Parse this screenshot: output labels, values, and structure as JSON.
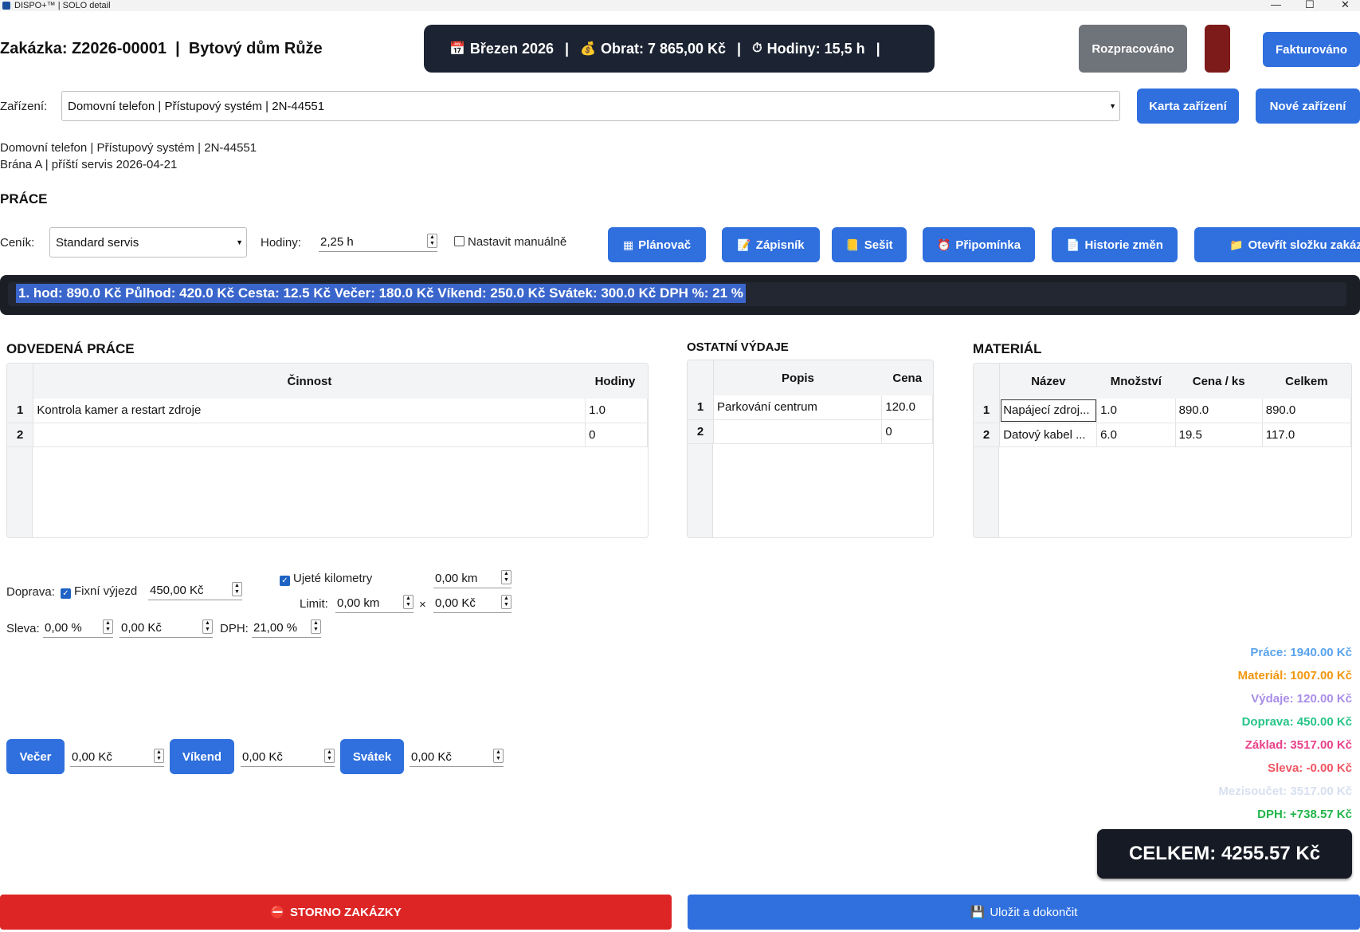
{
  "window": {
    "title": "DISPO+™ | SOLO detail",
    "minimize": "—",
    "maximize": "☐",
    "close": "✕"
  },
  "header": {
    "title": "Zakázka: Z2026-00001  |  Bytový dům Růže",
    "stats": {
      "month": "Březen 2026",
      "turnover": "Obrat: 7 865,00 Kč",
      "hours": "Hodiny: 15,5 h",
      "sep": "|"
    },
    "status_in_progress": "Rozpracováno",
    "status_invoiced": "Fakturováno",
    "colors": {
      "in_progress": "#6f737a",
      "red_swatch": "#7d1a1a",
      "accent": "#2f6fde"
    }
  },
  "device": {
    "label": "Zařízení:",
    "selected": "Domovní telefon | Přístupový systém | 2N-44551",
    "card_button": "Karta zařízení",
    "new_button": "Nové zařízení",
    "info_line1": "Domovní telefon | Přístupový systém | 2N-44551",
    "info_line2": "Brána A | příští servis 2026-04-21"
  },
  "work": {
    "section": "PRÁCE",
    "pricelist_label": "Ceník:",
    "pricelist_value": "Standard servis",
    "hours_label": "Hodiny:",
    "hours_value": "2,25 h",
    "manual_label": "Nastavit manuálně",
    "buttons": {
      "planner": "Plánovač",
      "notepad": "Zápisník",
      "notebook": "Sešit",
      "reminder": "Připomínka",
      "history": "Historie změn",
      "open_folder": "Otevřít složku zakáz"
    }
  },
  "rates": "1. hod: 890.0 Kč Půlhod: 420.0 Kč Cesta: 12.5 Kč Večer: 180.0 Kč Víkend: 250.0 Kč Svátek: 300.0 Kč DPH %: 21 %",
  "labor_table": {
    "title": "ODVEDENÁ PRÁCE",
    "headers": [
      "Činnost",
      "Hodiny"
    ],
    "rows": [
      {
        "n": "1",
        "activity": "Kontrola kamer a restart zdroje",
        "hours": "1.0"
      },
      {
        "n": "2",
        "activity": "",
        "hours": "0"
      }
    ]
  },
  "expenses_table": {
    "title": "OSTATNÍ VÝDAJE",
    "headers": [
      "Popis",
      "Cena"
    ],
    "rows": [
      {
        "n": "1",
        "desc": "Parkování centrum",
        "price": "120.0"
      },
      {
        "n": "2",
        "desc": "",
        "price": "0"
      }
    ]
  },
  "material_table": {
    "title": "MATERIÁL",
    "headers": [
      "Název",
      "Množství",
      "Cena / ks",
      "Celkem"
    ],
    "rows": [
      {
        "n": "1",
        "name": "Napájecí zdroj...",
        "qty": "1.0",
        "unit": "890.0",
        "total": "890.0"
      },
      {
        "n": "2",
        "name": "Datový kabel ...",
        "qty": "6.0",
        "unit": "19.5",
        "total": "117.0"
      }
    ]
  },
  "transport": {
    "label": "Doprava:",
    "fixed_label": "Fixní výjezd",
    "fixed_value": "450,00 Kč",
    "km_label": "Ujeté kilometry",
    "km_value": "0,00 km",
    "limit_label": "Limit:",
    "limit_value": "0,00 km",
    "times": "×",
    "rate_value": "0,00 Kč"
  },
  "discount": {
    "label": "Sleva:",
    "pct": "0,00 %",
    "amount": "0,00 Kč",
    "vat_label": "DPH:",
    "vat_value": "21,00 %"
  },
  "surcharges": {
    "evening": "Večer",
    "evening_value": "0,00 Kč",
    "weekend": "Víkend",
    "weekend_value": "0,00 Kč",
    "holiday": "Svátek",
    "holiday_value": "0,00 Kč"
  },
  "summary": {
    "labor": "Práce: 1940.00 Kč",
    "material": "Materiál: 1007.00 Kč",
    "expenses": "Výdaje: 120.00 Kč",
    "transport": "Doprava: 450.00 Kč",
    "base": "Základ: 3517.00 Kč",
    "discount": "Sleva: -0.00 Kč",
    "subtotal": "Mezisoučet: 3517.00 Kč",
    "vat": "DPH: +738.57 Kč",
    "total": "CELKEM: 4255.57 Kč",
    "colors": {
      "labor": "#5aa3ec",
      "material": "#f0960e",
      "expenses": "#a98ee8",
      "transport": "#27c488",
      "base": "#e8428a",
      "discount": "#ef5562",
      "subtotal": "#d7e0ef",
      "vat": "#22b54a"
    }
  },
  "footer": {
    "cancel": "STORNO ZAKÁZKY",
    "save": "Uložit a dokončit"
  }
}
